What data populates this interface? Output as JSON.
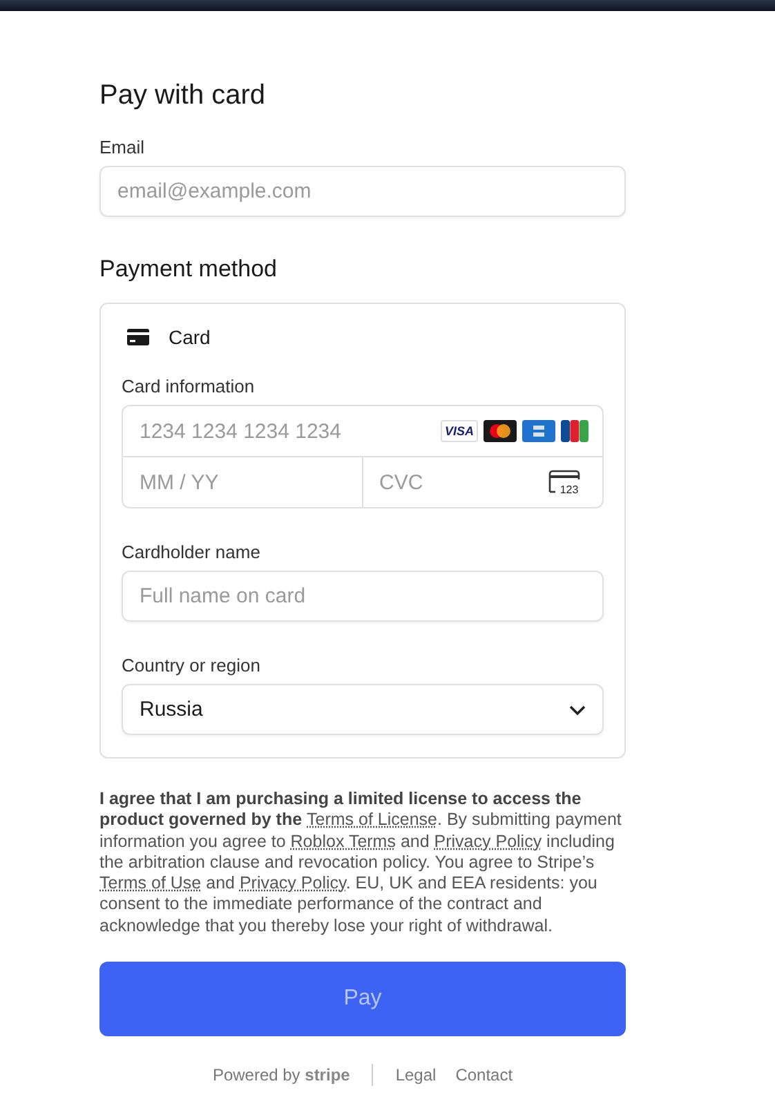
{
  "title": "Pay with card",
  "email": {
    "label": "Email",
    "placeholder": "email@example.com"
  },
  "payment_method": {
    "heading": "Payment method",
    "method": "Card",
    "card_information": {
      "label": "Card information",
      "number_placeholder": "1234 1234 1234 1234",
      "expiry_placeholder": "MM / YY",
      "cvc_placeholder": "CVC",
      "cvc_icon_text": "123",
      "brands": [
        {
          "kind": "visa",
          "text": "VISA"
        },
        {
          "kind": "mastercard"
        },
        {
          "kind": "amex"
        },
        {
          "kind": "jcb"
        }
      ]
    },
    "cardholder": {
      "label": "Cardholder name",
      "placeholder": "Full name on card"
    },
    "country": {
      "label": "Country or region",
      "value": "Russia"
    }
  },
  "consent": [
    {
      "kind": "bold",
      "text": "I agree that I am purchasing a limited license to access the product governed by the "
    },
    {
      "kind": "link",
      "text": "Terms of License"
    },
    {
      "kind": "plain",
      "text": ". By submitting payment information you agree to "
    },
    {
      "kind": "link",
      "text": "Roblox Terms"
    },
    {
      "kind": "plain",
      "text": " and "
    },
    {
      "kind": "link",
      "text": "Privacy Policy"
    },
    {
      "kind": "plain",
      "text": " including the arbitration clause and revocation policy. You agree to Stripe’s "
    },
    {
      "kind": "link",
      "text": "Terms of Use"
    },
    {
      "kind": "plain",
      "text": " and "
    },
    {
      "kind": "link",
      "text": "Privacy Policy"
    },
    {
      "kind": "plain",
      "text": ". EU, UK and EEA residents: you consent to the immediate performance of the contract and acknowledge that you thereby lose your right of withdrawal."
    }
  ],
  "pay_button": "Pay",
  "footer": {
    "powered_by": "Powered by",
    "brand": "stripe",
    "links": [
      "Legal",
      "Contact"
    ]
  }
}
